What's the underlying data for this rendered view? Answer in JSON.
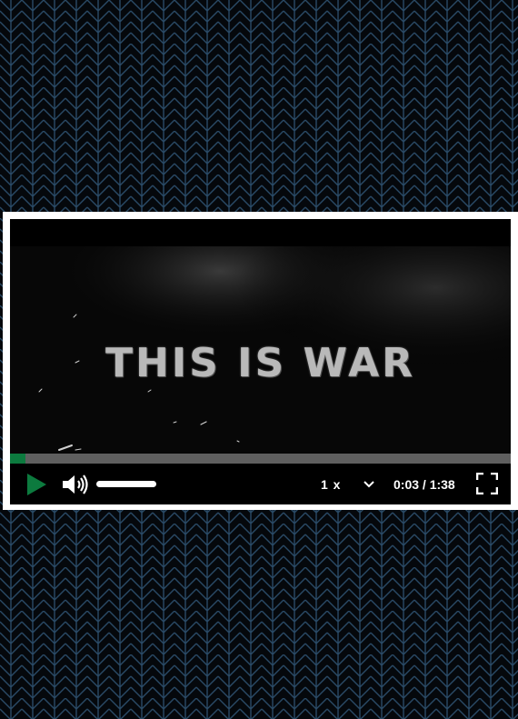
{
  "video": {
    "title_text": "THIS IS WAR"
  },
  "player": {
    "progress_fraction": 0.031,
    "volume_fraction": 1.0,
    "playback_speed": "1 x",
    "time_display": "0:03 / 1:38",
    "state": "paused",
    "accent_color": "#0c7a3e"
  },
  "icons": {
    "play": "play-icon",
    "volume": "volume-icon",
    "speed": "chevron-down-icon",
    "fullscreen": "fullscreen-icon"
  }
}
